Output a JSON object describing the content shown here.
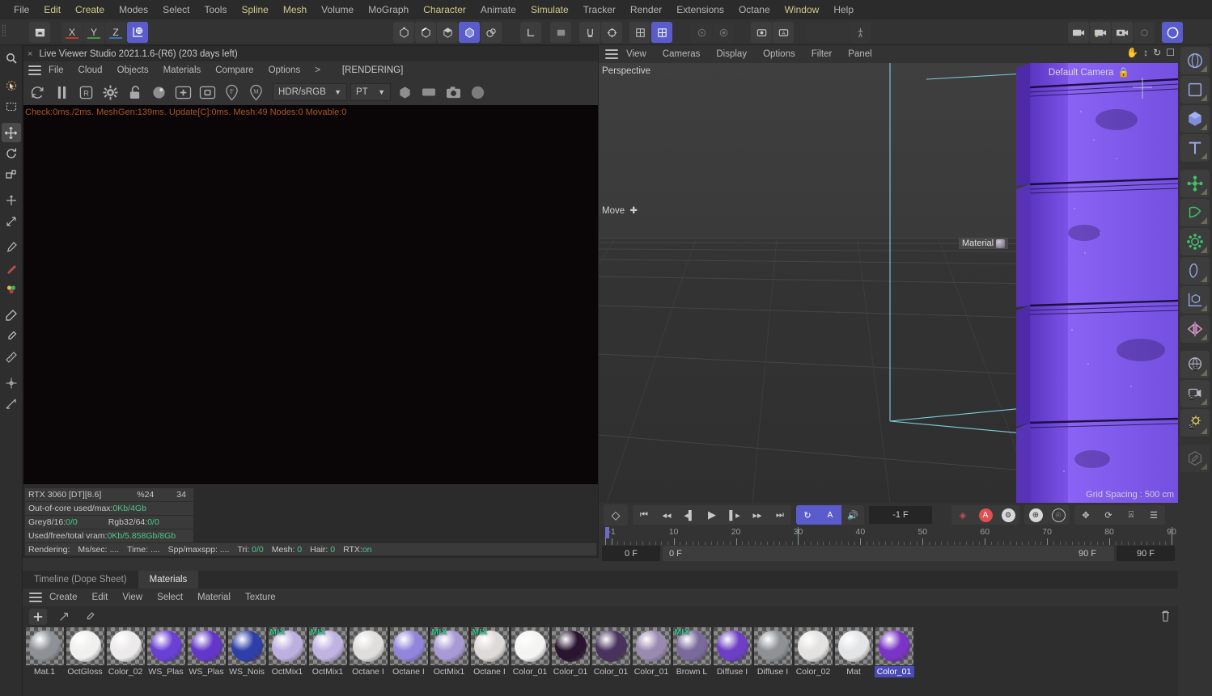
{
  "menubar": {
    "items": [
      {
        "label": "File",
        "hl": false
      },
      {
        "label": "Edit",
        "hl": true
      },
      {
        "label": "Create",
        "hl": true
      },
      {
        "label": "Modes",
        "hl": false
      },
      {
        "label": "Select",
        "hl": false
      },
      {
        "label": "Tools",
        "hl": false
      },
      {
        "label": "Spline",
        "hl": true
      },
      {
        "label": "Mesh",
        "hl": true
      },
      {
        "label": "Volume",
        "hl": false
      },
      {
        "label": "MoGraph",
        "hl": false
      },
      {
        "label": "Character",
        "hl": true
      },
      {
        "label": "Animate",
        "hl": false
      },
      {
        "label": "Simulate",
        "hl": true
      },
      {
        "label": "Tracker",
        "hl": false
      },
      {
        "label": "Render",
        "hl": false
      },
      {
        "label": "Extensions",
        "hl": false
      },
      {
        "label": "Octane",
        "hl": false
      },
      {
        "label": "Window",
        "hl": true
      },
      {
        "label": "Help",
        "hl": false
      }
    ]
  },
  "toptoolbar": {
    "axes": [
      "X",
      "Y",
      "Z"
    ],
    "world_label": "world-coordinate-toggle"
  },
  "live_viewer": {
    "title": "Live Viewer Studio 2021.1.6-(R6) (203 days left)",
    "close_label": "×",
    "menu": [
      "File",
      "Cloud",
      "Objects",
      "Materials",
      "Compare",
      "Options",
      ">"
    ],
    "rendering_badge": "[RENDERING]",
    "colorspace": "HDR/sRGB",
    "kernel": "PT",
    "stats_line": "Check:0ms./2ms. MeshGen:139ms. Update[C]:0ms. Mesh:49 Nodes:0 Movable:0",
    "gpu_row": {
      "name": "RTX 3060 [DT][8.6]",
      "percent": "%24",
      "temp": "34"
    },
    "out_of_core": {
      "label": "Out-of-core used/max:",
      "value": "0Kb/4Gb"
    },
    "grey_row": {
      "label1": "Grey8/16: ",
      "value1": "0/0",
      "label2": "Rgb32/64: ",
      "value2": "0/0"
    },
    "vram_row": {
      "label": "Used/free/total vram: ",
      "value": "0Kb/5.858Gb/8Gb"
    },
    "bottom": {
      "rendering": "Rendering:",
      "mssec": "Ms/sec: ....",
      "time": "Time: ....",
      "spp": "Spp/maxspp: ....",
      "tri_label": "Tri: ",
      "tri": "0/0",
      "mesh_label": "Mesh: ",
      "mesh": "0",
      "hair_label": "Hair: ",
      "hair": "0",
      "rtx_label": "RTX:",
      "rtx": "on"
    }
  },
  "viewport": {
    "menu": [
      "View",
      "Cameras",
      "Display",
      "Options",
      "Filter",
      "Panel"
    ],
    "label_topleft": "Perspective",
    "label_topright": "Default Camera",
    "move_label": "Move",
    "material_tooltip": "Material",
    "grid_spacing": "Grid Spacing : 500 cm",
    "icons": [
      "hand-icon",
      "move-vertical-icon",
      "rotate-icon",
      "maximize-icon"
    ]
  },
  "timeline": {
    "current_frame": "-1 F",
    "start_field": "0 F",
    "end_field_left": "0 F",
    "scroll_label": "90 F",
    "end_field": "90 F",
    "ticks": [
      {
        "label": "-1",
        "value": -1
      },
      {
        "label": "10",
        "value": 10
      },
      {
        "label": "20",
        "value": 20
      },
      {
        "label": "30",
        "value": 30
      },
      {
        "label": "40",
        "value": 40
      },
      {
        "label": "50",
        "value": 50
      },
      {
        "label": "60",
        "value": 60
      },
      {
        "label": "70",
        "value": 70
      },
      {
        "label": "80",
        "value": 80
      },
      {
        "label": "90",
        "value": 90
      }
    ],
    "transport": [
      "go-to-start-icon",
      "prev-key-icon",
      "prev-frame-icon",
      "play-icon",
      "next-frame-icon",
      "next-key-icon",
      "go-to-end-icon"
    ],
    "toggles": [
      "loop-icon",
      "autokey-icon",
      "sound-icon"
    ]
  },
  "material_manager": {
    "tabs": [
      {
        "label": "Timeline (Dope Sheet)",
        "active": false
      },
      {
        "label": "Materials",
        "active": true
      }
    ],
    "menu": [
      "Create",
      "Edit",
      "View",
      "Select",
      "Material",
      "Texture"
    ],
    "toolbar_icons": [
      "add-material-icon",
      "apply-material-icon",
      "pick-material-icon",
      "delete-material-icon"
    ],
    "materials": [
      {
        "name": "Mat.1",
        "color": "#8e9296",
        "mix": false,
        "selected": false
      },
      {
        "name": "OctGloss",
        "color": "#f0f0ee",
        "mix": false,
        "selected": false
      },
      {
        "name": "Color_02",
        "color": "#eceaea",
        "mix": false,
        "selected": false
      },
      {
        "name": "WS_Plas",
        "color": "#6a3fd4",
        "mix": false,
        "selected": false
      },
      {
        "name": "WS_Plas",
        "color": "#6338c8",
        "mix": false,
        "selected": false
      },
      {
        "name": "WS_Nois",
        "color": "#2f3fa8",
        "mix": false,
        "selected": false
      },
      {
        "name": "OctMix1",
        "color": "#bdb0e0",
        "mix": true,
        "selected": false
      },
      {
        "name": "OctMix1",
        "color": "#c0b3e2",
        "mix": true,
        "selected": false
      },
      {
        "name": "Octane I",
        "color": "#e0dedc",
        "mix": false,
        "selected": false
      },
      {
        "name": "Octane I",
        "color": "#9286dc",
        "mix": false,
        "selected": false
      },
      {
        "name": "OctMix1",
        "color": "#a99ad6",
        "mix": true,
        "selected": false
      },
      {
        "name": "Octane I",
        "color": "#dedad8",
        "mix": true,
        "selected": false
      },
      {
        "name": "Color_01",
        "color": "#f4f4f2",
        "mix": false,
        "selected": false
      },
      {
        "name": "Color_01",
        "color": "#2a1430",
        "mix": false,
        "selected": false
      },
      {
        "name": "Color_01",
        "color": "#49335e",
        "mix": false,
        "selected": false
      },
      {
        "name": "Color_01",
        "color": "#9a8ab0",
        "mix": false,
        "selected": false
      },
      {
        "name": "Brown L",
        "color": "#7a6a9c",
        "mix": true,
        "selected": false
      },
      {
        "name": "Diffuse I",
        "color": "#6c3fc4",
        "mix": false,
        "selected": false
      },
      {
        "name": "Diffuse I",
        "color": "#8e9296",
        "mix": false,
        "selected": false
      },
      {
        "name": "Color_02",
        "color": "#e4e2e0",
        "mix": false,
        "selected": false
      },
      {
        "name": "Mat",
        "color": "#e2e4e6",
        "mix": false,
        "selected": false
      },
      {
        "name": "Color_01",
        "color": "#7a34c6",
        "mix": false,
        "selected": true
      }
    ]
  },
  "rail": {
    "items": [
      "sphere-primitive-icon",
      "square-primitive-icon",
      "cube-primitive-icon",
      "text-tool-icon",
      "mograph-cloner-icon",
      "deformer-icon",
      "gear-icon",
      "spline-icon",
      "axis-cube-icon",
      "symmetry-icon",
      "globe-render-icon",
      "camera-render-icon",
      "light-render-icon",
      "paint-tool-icon"
    ]
  },
  "lefttools": {
    "items": [
      "search-icon",
      "live-selection-icon",
      "move-icon",
      "rotate-icon",
      "scale-icon",
      "magnet-icon",
      "cursor-icon",
      "brush-icon",
      "pen-icon",
      "knife-icon",
      "color-icon",
      "pencil-icon",
      "eyedropper-icon",
      "measure-icon",
      "snap-icon",
      "workplane-icon"
    ]
  },
  "colors": {
    "accent_blue": "#5a5ccc",
    "select_blue": "#4a4ab8",
    "stats_orange": "#a8582a",
    "stats_green": "#4fc58a",
    "panel_bg": "#333333",
    "viewport_bg": "#3b3b3b"
  }
}
